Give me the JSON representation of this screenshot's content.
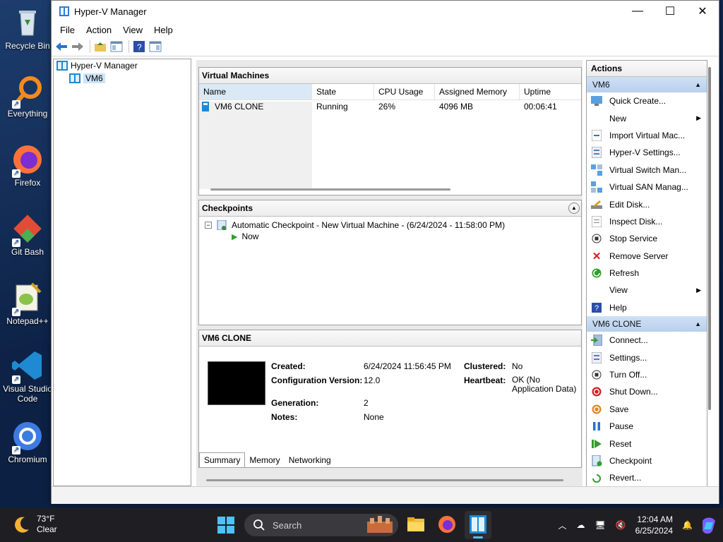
{
  "desktop": {
    "icons": [
      {
        "label": "Recycle Bin"
      },
      {
        "label": "Everything"
      },
      {
        "label": "Firefox"
      },
      {
        "label": "Git Bash"
      },
      {
        "label": "Notepad++"
      },
      {
        "label": "Visual Studio Code"
      },
      {
        "label": "Chromium"
      }
    ]
  },
  "window": {
    "title": "Hyper-V Manager",
    "menu": [
      "File",
      "Action",
      "View",
      "Help"
    ]
  },
  "tree": {
    "root": "Hyper-V Manager",
    "child": "VM6"
  },
  "vm_panel": {
    "title": "Virtual Machines",
    "columns": [
      "Name",
      "State",
      "CPU Usage",
      "Assigned Memory",
      "Uptime"
    ],
    "rows": [
      {
        "name": "VM6 CLONE",
        "state": "Running",
        "cpu": "26%",
        "memory": "4096 MB",
        "uptime": "00:06:41"
      }
    ]
  },
  "checkpoints": {
    "title": "Checkpoints",
    "items": [
      "Automatic Checkpoint - New Virtual Machine - (6/24/2024 - 11:58:00 PM)",
      "Now"
    ]
  },
  "details": {
    "title": "VM6 CLONE",
    "created_label": "Created:",
    "created": "6/24/2024 11:56:45 PM",
    "config_label": "Configuration Version:",
    "config": "12.0",
    "generation_label": "Generation:",
    "generation": "2",
    "notes_label": "Notes:",
    "notes": "None",
    "clustered_label": "Clustered:",
    "clustered": "No",
    "heartbeat_label": "Heartbeat:",
    "heartbeat": "OK (No Application Data)",
    "tabs": [
      "Summary",
      "Memory",
      "Networking"
    ]
  },
  "actions": {
    "title": "Actions",
    "group1": "VM6",
    "group1_items": [
      "Quick Create...",
      "New",
      "Import Virtual Mac...",
      "Hyper-V Settings...",
      "Virtual Switch Man...",
      "Virtual SAN Manag...",
      "Edit Disk...",
      "Inspect Disk...",
      "Stop Service",
      "Remove Server",
      "Refresh",
      "View",
      "Help"
    ],
    "group2": "VM6 CLONE",
    "group2_items": [
      "Connect...",
      "Settings...",
      "Turn Off...",
      "Shut Down...",
      "Save",
      "Pause",
      "Reset",
      "Checkpoint",
      "Revert..."
    ]
  },
  "taskbar": {
    "temp": "73°F",
    "weather": "Clear",
    "search": "Search",
    "time": "12:04 AM",
    "date": "6/25/2024"
  }
}
